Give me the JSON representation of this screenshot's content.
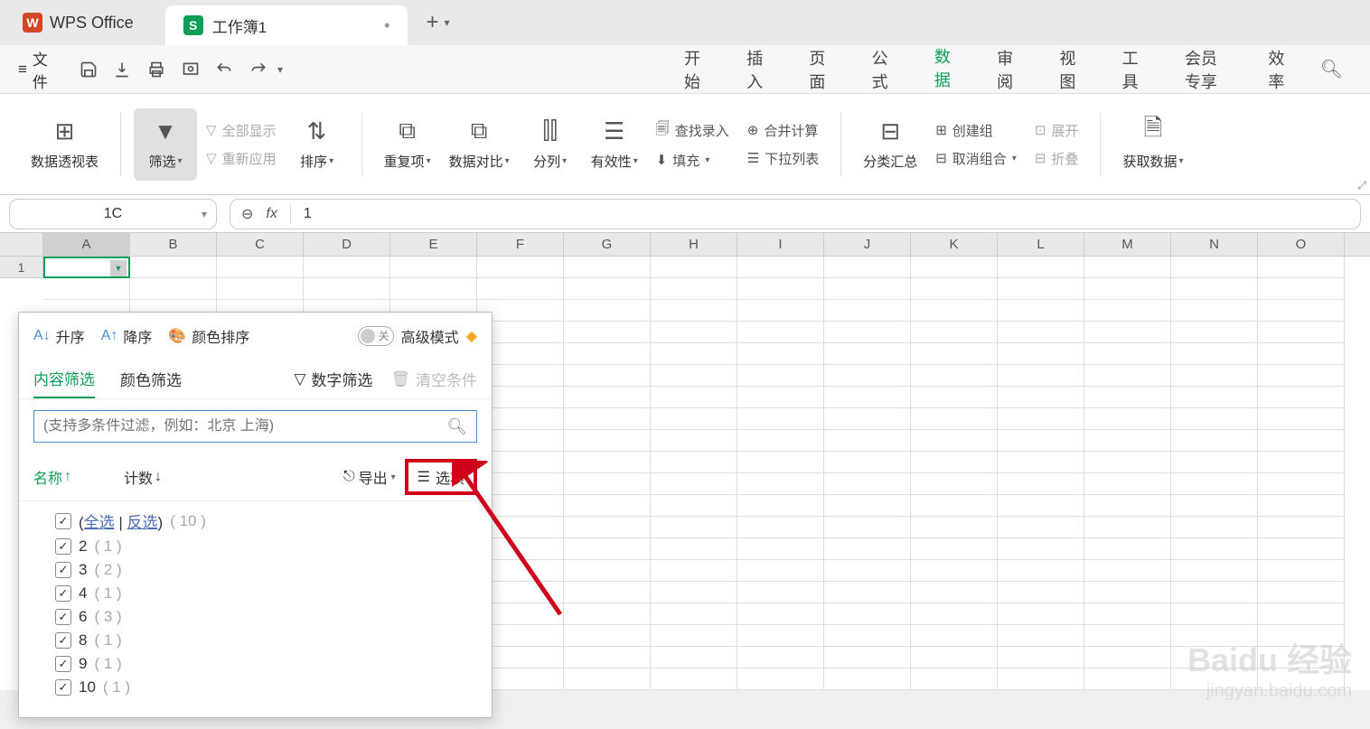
{
  "app": {
    "name": "WPS Office"
  },
  "tab": {
    "title": "工作簿1"
  },
  "quick": {
    "file": "文件"
  },
  "menu": {
    "items": [
      "开始",
      "插入",
      "页面",
      "公式",
      "数据",
      "审阅",
      "视图",
      "工具",
      "会员专享",
      "效率"
    ],
    "active": "数据"
  },
  "ribbon": {
    "pivot": "数据透视表",
    "filter": "筛选",
    "show_all": "全部显示",
    "reapply": "重新应用",
    "sort": "排序",
    "duplicates": "重复项",
    "data_compare": "数据对比",
    "split_col": "分列",
    "validation": "有效性",
    "find_entry": "查找录入",
    "merge_calc": "合并计算",
    "fill": "填充",
    "dropdown": "下拉列表",
    "subtotal": "分类汇总",
    "group": "创建组",
    "ungroup": "取消组合",
    "expand": "展开",
    "collapse": "折叠",
    "get_data": "获取数据"
  },
  "namebox": {
    "value": "1C"
  },
  "formula": {
    "value": "1"
  },
  "columns": [
    "A",
    "B",
    "C",
    "D",
    "E",
    "F",
    "G",
    "H",
    "I",
    "J",
    "K",
    "L",
    "M",
    "N",
    "O"
  ],
  "row1": "1",
  "filter_panel": {
    "asc": "升序",
    "desc": "降序",
    "color_sort": "颜色排序",
    "adv_mode": "高级模式",
    "tab_content": "内容筛选",
    "tab_color": "颜色筛选",
    "num_filter": "数字筛选",
    "clear": "清空条件",
    "search_placeholder": "(支持多条件过滤，例如：北京 上海)",
    "header_name": "名称",
    "header_count": "计数",
    "export": "导出",
    "options": "选项",
    "select_all": "全选",
    "invert": "反选",
    "total_count": "( 10 )",
    "items": [
      {
        "label": "2",
        "count": "( 1 )"
      },
      {
        "label": "3",
        "count": "( 2 )"
      },
      {
        "label": "4",
        "count": "( 1 )"
      },
      {
        "label": "6",
        "count": "( 3 )"
      },
      {
        "label": "8",
        "count": "( 1 )"
      },
      {
        "label": "9",
        "count": "( 1 )"
      },
      {
        "label": "10",
        "count": "( 1 )"
      }
    ]
  },
  "watermark": {
    "main": "Baidu 经验",
    "sub": "jingyan.baidu.com"
  }
}
